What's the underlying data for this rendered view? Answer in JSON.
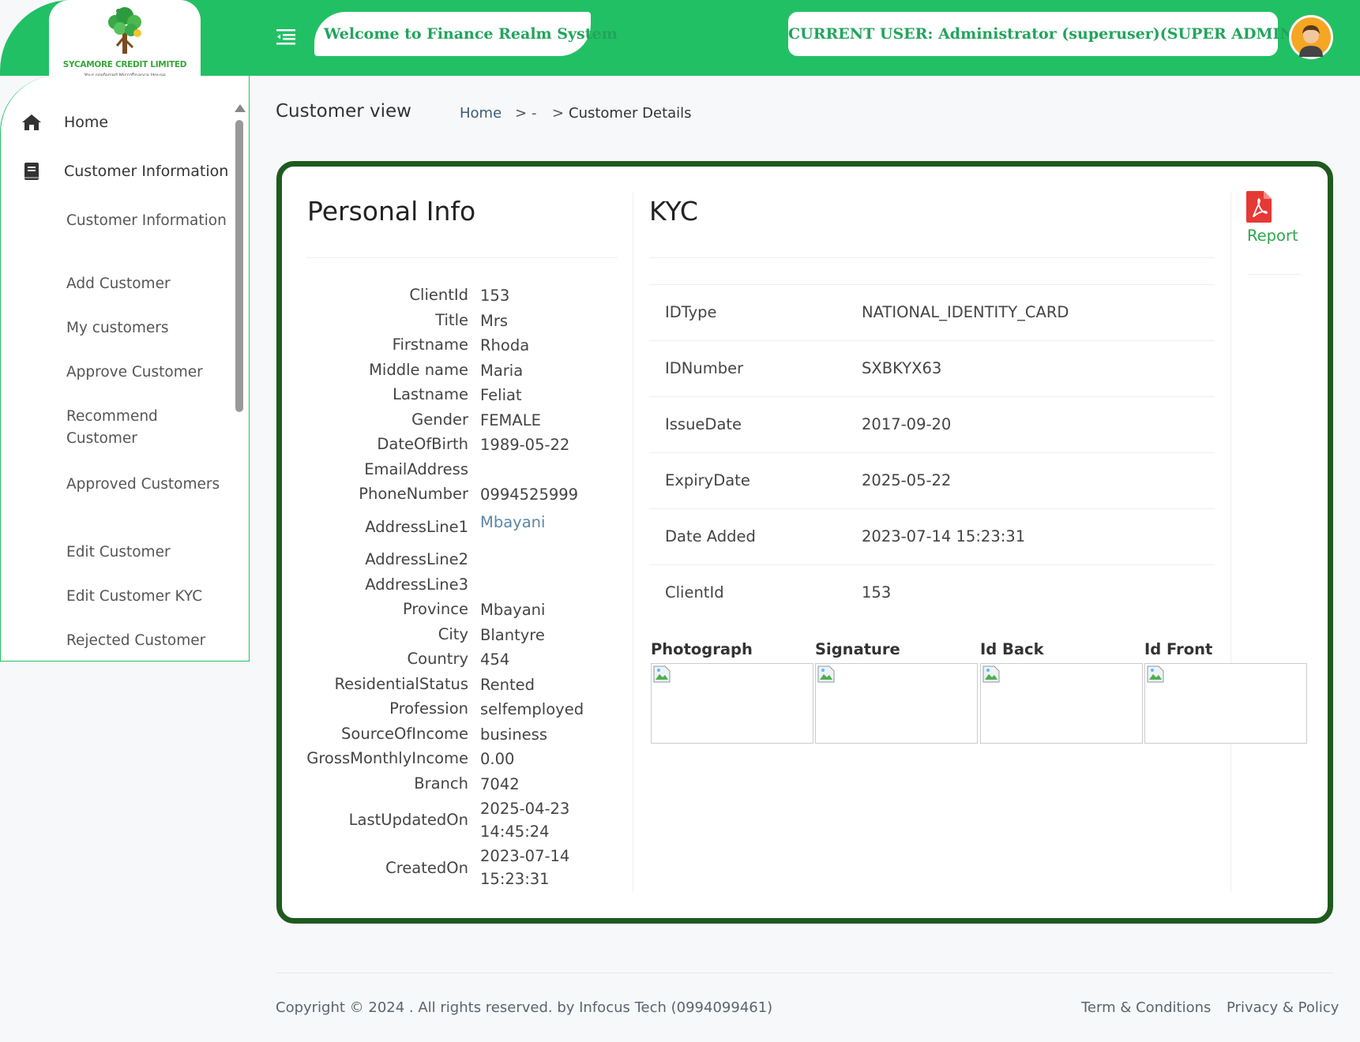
{
  "header": {
    "company_name": "SYCAMORE CREDIT LIMITED",
    "company_tagline": "Your preferred Microfinance House",
    "welcome": "Welcome to Finance Realm System",
    "current_user": "CURRENT USER: Administrator (superuser)(SUPER ADMIN)"
  },
  "sidebar": {
    "home": "Home",
    "customer_info_group": "Customer Information",
    "items": [
      "Customer Information",
      "Add Customer",
      "My customers",
      "Approve Customer",
      "Recommend Customer",
      "Approved Customers",
      "Edit Customer",
      "Edit Customer KYC",
      "Rejected Customer"
    ]
  },
  "page": {
    "title": "Customer view",
    "breadcrumb": {
      "home": "Home",
      "sep": ">",
      "mid": "-",
      "current": "Customer Details"
    }
  },
  "personal": {
    "heading": "Personal Info",
    "rows": [
      {
        "label": "ClientId",
        "value": "153"
      },
      {
        "label": "Title",
        "value": "Mrs"
      },
      {
        "label": "Firstname",
        "value": "Rhoda"
      },
      {
        "label": "Middle name",
        "value": "Maria"
      },
      {
        "label": "Lastname",
        "value": "Feliat"
      },
      {
        "label": "Gender",
        "value": "FEMALE"
      },
      {
        "label": "DateOfBirth",
        "value": "1989-05-22"
      },
      {
        "label": "EmailAddress",
        "value": ""
      },
      {
        "label": "PhoneNumber",
        "value": "0994525999"
      },
      {
        "label": "AddressLine1",
        "value": "Mbayani"
      },
      {
        "label": "AddressLine2",
        "value": ""
      },
      {
        "label": "AddressLine3",
        "value": ""
      },
      {
        "label": "Province",
        "value": "Mbayani"
      },
      {
        "label": "City",
        "value": "Blantyre"
      },
      {
        "label": "Country",
        "value": "454"
      },
      {
        "label": "ResidentialStatus",
        "value": "Rented"
      },
      {
        "label": "Profession",
        "value": "selfemployed"
      },
      {
        "label": "SourceOfIncome",
        "value": "business"
      },
      {
        "label": "GrossMonthlyIncome",
        "value": "0.00"
      },
      {
        "label": "Branch",
        "value": "7042"
      },
      {
        "label": "LastUpdatedOn",
        "value_line1": "2025-04-23",
        "value_line2": "14:45:24"
      },
      {
        "label": "CreatedOn",
        "value_line1": "2023-07-14",
        "value_line2": "15:23:31"
      }
    ]
  },
  "kyc": {
    "heading": "KYC",
    "report_label": "Report",
    "rows": [
      {
        "label": "IDType",
        "value": "NATIONAL_IDENTITY_CARD"
      },
      {
        "label": "IDNumber",
        "value": "SXBKYX63"
      },
      {
        "label": "IssueDate",
        "value": "2017-09-20"
      },
      {
        "label": "ExpiryDate",
        "value": "2025-05-22"
      },
      {
        "label": "Date Added",
        "value": "2023-07-14 15:23:31"
      },
      {
        "label": "ClientId",
        "value": "153"
      }
    ],
    "images": [
      "Photograph",
      "Signature",
      "Id Back",
      "Id Front"
    ]
  },
  "footer": {
    "copyright": "Copyright © 2024 . All rights reserved. by Infocus Tech (0994099461)",
    "terms": "Term & Conditions",
    "privacy": "Privacy & Policy"
  },
  "colors": {
    "brand_green": "#22c064",
    "card_border": "#1e5a1e",
    "report_red": "#e53935"
  }
}
